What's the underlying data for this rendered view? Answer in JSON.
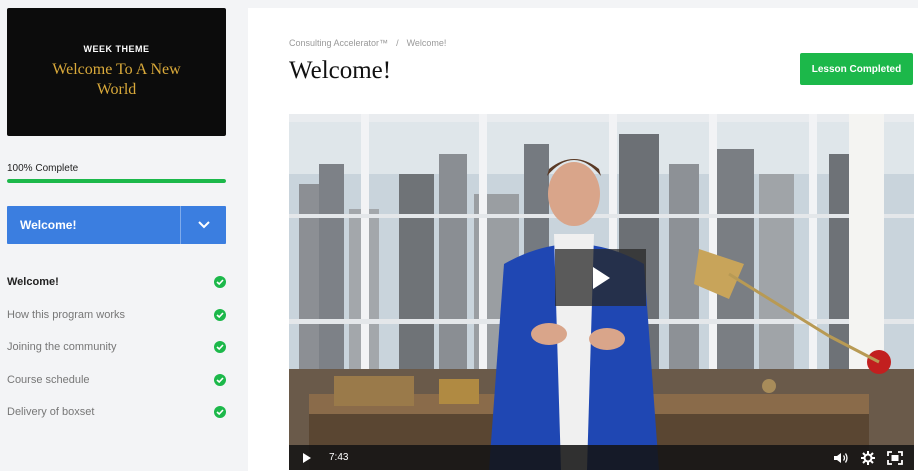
{
  "sidebar": {
    "theme_eyebrow": "WEEK THEME",
    "theme_title": "Welcome To A New World",
    "progress_label": "100% Complete",
    "progress_fraction": 1.0,
    "module_label": "Welcome!",
    "lessons": [
      {
        "label": "Welcome!",
        "active": true,
        "completed": true
      },
      {
        "label": "How this program works",
        "active": false,
        "completed": true
      },
      {
        "label": "Joining the community",
        "active": false,
        "completed": true
      },
      {
        "label": "Course schedule",
        "active": false,
        "completed": true
      },
      {
        "label": "Delivery of boxset",
        "active": false,
        "completed": true
      }
    ]
  },
  "main": {
    "breadcrumb": [
      "Consulting Accelerator™",
      "Welcome!"
    ],
    "breadcrumb_separator": "/",
    "title": "Welcome!",
    "complete_button_label": "Lesson Completed"
  },
  "video": {
    "current_time": "7:43",
    "icons": [
      "play-icon",
      "volume-icon",
      "settings-icon",
      "fullscreen-icon"
    ]
  },
  "colors": {
    "accent_blue": "#3b7ee0",
    "success_green": "#1cb84a",
    "theme_gold": "#d9a93a"
  }
}
